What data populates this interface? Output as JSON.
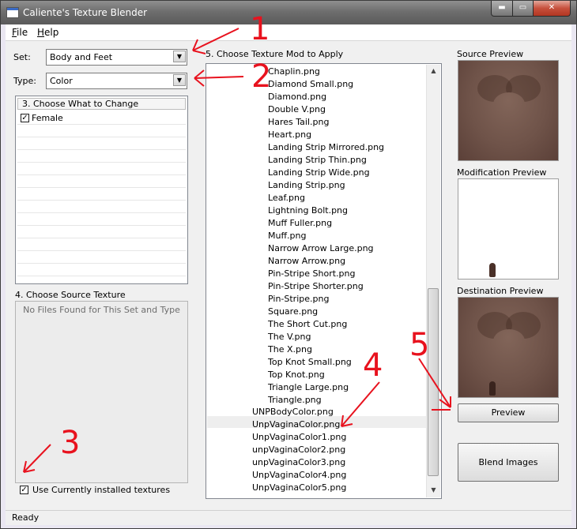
{
  "window": {
    "title": "Caliente's Texture Blender",
    "minimize_glyph": "▬",
    "maximize_glyph": "▭",
    "close_glyph": "✕"
  },
  "menu": {
    "file": {
      "accel": "F",
      "rest": "ile"
    },
    "help": {
      "accel": "H",
      "rest": "elp"
    }
  },
  "set": {
    "label": "Set:",
    "value": "Body and Feet"
  },
  "type": {
    "label": "Type:",
    "value": "Color"
  },
  "dropdown_glyph": "▼",
  "what_to_change": {
    "header": "3. Choose What to Change",
    "items": [
      {
        "label": "Female",
        "checked": true
      }
    ],
    "check_glyph": "✓"
  },
  "source_texture": {
    "header": "4. Choose Source Texture",
    "empty_message": "No Files Found for This Set and Type"
  },
  "use_installed": {
    "label": "Use Currently installed textures",
    "checked": true
  },
  "texture_mod": {
    "header": "5. Choose Texture Mod to Apply",
    "child_items": [
      "Chaplin.png",
      "Diamond Small.png",
      "Diamond.png",
      "Double V.png",
      "Hares Tail.png",
      "Heart.png",
      "Landing Strip Mirrored.png",
      "Landing Strip Thin.png",
      "Landing Strip Wide.png",
      "Landing Strip.png",
      "Leaf.png",
      "Lightning Bolt.png",
      "Muff Fuller.png",
      "Muff.png",
      "Narrow Arrow Large.png",
      "Narrow Arrow.png",
      "Pin-Stripe Short.png",
      "Pin-Stripe Shorter.png",
      "Pin-Stripe.png",
      "Square.png",
      "The Short Cut.png",
      "The V.png",
      "The X.png",
      "Top Knot Small.png",
      "Top Knot.png",
      "Triangle Large.png",
      "Triangle.png"
    ],
    "root_items": [
      "UNPBodyColor.png",
      "UnpVaginaColor.png",
      "UnpVaginaColor1.png",
      "unpVaginaColor2.png",
      "unpVaginaColor3.png",
      "UnpVaginaColor4.png",
      "UnpVaginaColor5.png"
    ],
    "selected_root_index": 1,
    "scroll_up_glyph": "▲",
    "scroll_down_glyph": "▼"
  },
  "previews": {
    "source": "Source Preview",
    "modification": "Modification Preview",
    "destination": "Destination Preview"
  },
  "buttons": {
    "preview": "Preview",
    "blend": "Blend Images"
  },
  "status": "Ready",
  "annotations": [
    "1",
    "2",
    "3",
    "4",
    "5"
  ],
  "annotation_color": "#e8121e"
}
